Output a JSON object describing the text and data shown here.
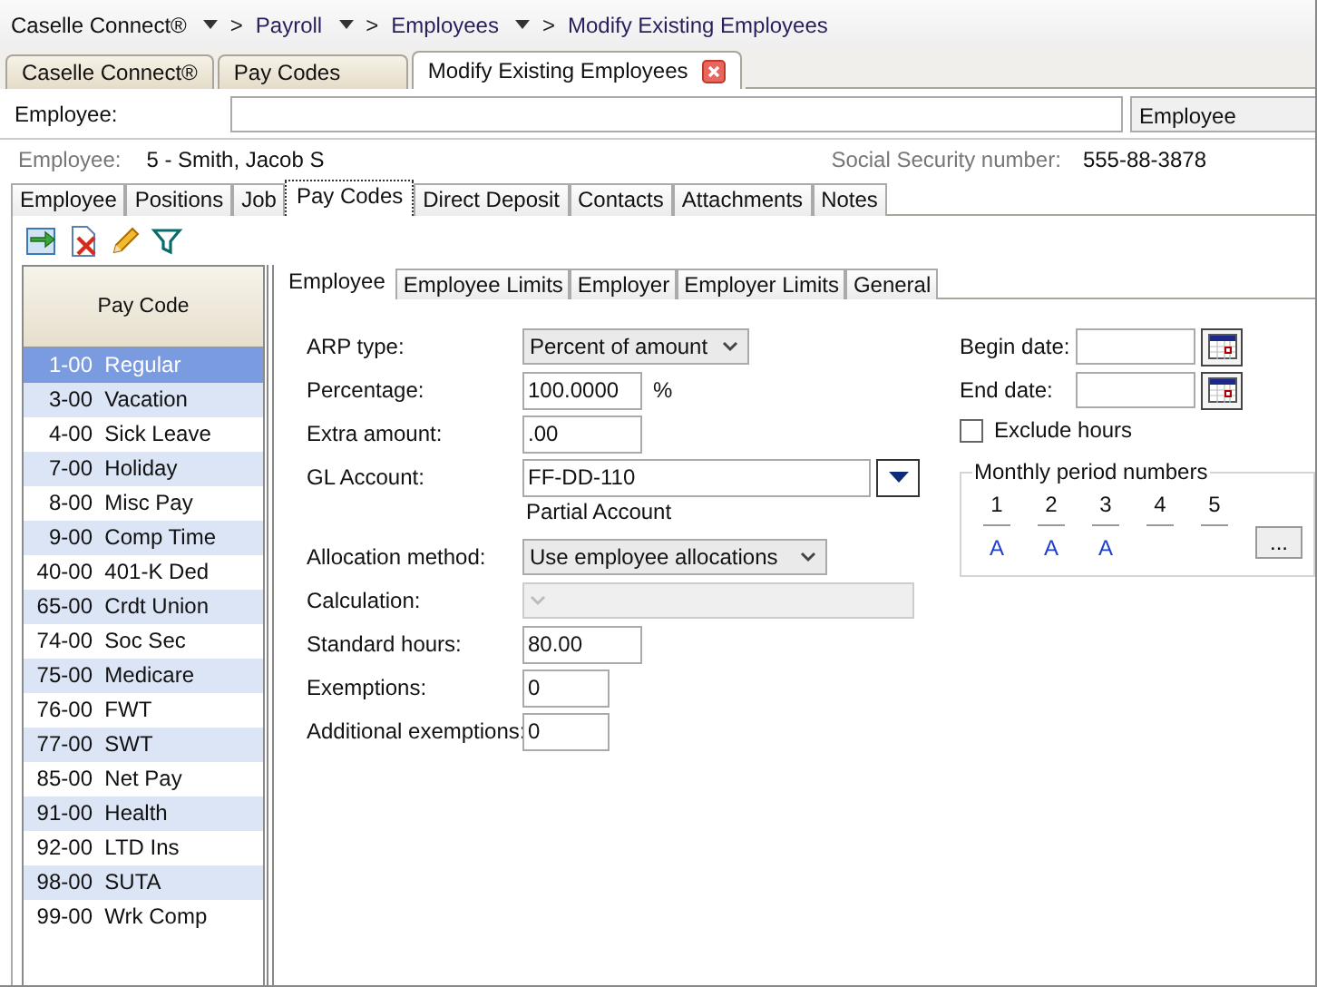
{
  "breadcrumb": {
    "separator": ">",
    "items": [
      {
        "label": "Caselle Connect®",
        "has_menu": true
      },
      {
        "label": "Payroll",
        "has_menu": true
      },
      {
        "label": "Employees",
        "has_menu": true
      },
      {
        "label": "Modify Existing Employees",
        "has_menu": false
      }
    ]
  },
  "document_tabs": [
    {
      "label": "Caselle Connect®",
      "selected": false,
      "closable": false
    },
    {
      "label": "Pay Codes",
      "selected": false,
      "closable": false
    },
    {
      "label": "Modify Existing Employees",
      "selected": true,
      "closable": true
    }
  ],
  "employee_search": {
    "label": "Employee:",
    "type_value": "Employee"
  },
  "employee_info": {
    "label": "Employee:",
    "value": "5 - Smith, Jacob S",
    "ssn_label": "Social Security number:",
    "ssn_value": "555-88-3878"
  },
  "employee_tabs": [
    {
      "label": "Employee",
      "selected": false
    },
    {
      "label": "Positions",
      "selected": false
    },
    {
      "label": "Job",
      "selected": false
    },
    {
      "label": "Pay Codes",
      "selected": true
    },
    {
      "label": "Direct Deposit",
      "selected": false
    },
    {
      "label": "Contacts",
      "selected": false
    },
    {
      "label": "Attachments",
      "selected": false
    },
    {
      "label": "Notes",
      "selected": false
    }
  ],
  "toolbar": [
    {
      "kind": "import"
    },
    {
      "kind": "delete"
    },
    {
      "kind": "edit"
    },
    {
      "kind": "filter"
    }
  ],
  "pay_code_list": {
    "header": "Pay Code",
    "rows": [
      {
        "code": "1-00",
        "name": "Regular",
        "selected": true
      },
      {
        "code": "3-00",
        "name": "Vacation",
        "selected": false
      },
      {
        "code": "4-00",
        "name": "Sick Leave",
        "selected": false
      },
      {
        "code": "7-00",
        "name": "Holiday",
        "selected": false
      },
      {
        "code": "8-00",
        "name": "Misc Pay",
        "selected": false
      },
      {
        "code": "9-00",
        "name": "Comp Time",
        "selected": false
      },
      {
        "code": "40-00",
        "name": "401-K Ded",
        "selected": false
      },
      {
        "code": "65-00",
        "name": "Crdt Union",
        "selected": false
      },
      {
        "code": "74-00",
        "name": "Soc Sec",
        "selected": false
      },
      {
        "code": "75-00",
        "name": "Medicare",
        "selected": false
      },
      {
        "code": "76-00",
        "name": "FWT",
        "selected": false
      },
      {
        "code": "77-00",
        "name": "SWT",
        "selected": false
      },
      {
        "code": "85-00",
        "name": "Net Pay",
        "selected": false
      },
      {
        "code": "91-00",
        "name": "Health",
        "selected": false
      },
      {
        "code": "92-00",
        "name": "LTD Ins",
        "selected": false
      },
      {
        "code": "98-00",
        "name": "SUTA",
        "selected": false
      },
      {
        "code": "99-00",
        "name": "Wrk Comp",
        "selected": false
      }
    ]
  },
  "detail_tabs": [
    {
      "label": "Employee",
      "selected": true
    },
    {
      "label": "Employee Limits",
      "selected": false
    },
    {
      "label": "Employer",
      "selected": false
    },
    {
      "label": "Employer Limits",
      "selected": false
    },
    {
      "label": "General",
      "selected": false
    }
  ],
  "fields": [
    {
      "kind": "select",
      "label": "ARP type:",
      "value": "Percent of amount",
      "disabled": false
    },
    {
      "kind": "text",
      "label": "Percentage:",
      "value": "100.0000",
      "suffix": "%"
    },
    {
      "kind": "text",
      "label": "Extra amount:",
      "value": ".00"
    },
    {
      "kind": "lookup",
      "label": "GL Account:",
      "value": "FF-DD-110",
      "note": "Partial Account"
    },
    {
      "kind": "select",
      "label": "Allocation method:",
      "value": "Use employee allocations",
      "disabled": false
    },
    {
      "kind": "select",
      "label": "Calculation:",
      "disabled": true
    },
    {
      "kind": "text",
      "label": "Standard hours:",
      "value": "80.00"
    },
    {
      "kind": "text",
      "label": "Exemptions:",
      "value": "0"
    },
    {
      "kind": "text",
      "label": "Additional exemptions:",
      "value": "0"
    }
  ],
  "dates": [
    {
      "label": "Begin date:"
    },
    {
      "label": "End date:"
    }
  ],
  "exclude_hours": {
    "label": "Exclude hours",
    "checked": false
  },
  "monthly_periods": {
    "title": "Monthly period numbers",
    "button": "...",
    "periods": [
      {
        "number": "1",
        "value": "A"
      },
      {
        "number": "2",
        "value": "A"
      },
      {
        "number": "3",
        "value": "A"
      },
      {
        "number": "4"
      },
      {
        "number": "5"
      }
    ]
  }
}
